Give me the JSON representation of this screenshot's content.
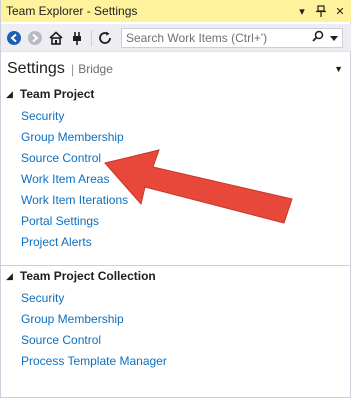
{
  "window": {
    "title": "Team Explorer - Settings"
  },
  "titlebar_buttons": {
    "dropdown": "▾",
    "pin": "ᛋ",
    "close": "✕"
  },
  "toolbar": {
    "search_placeholder": "Search Work Items (Ctrl+')",
    "icons": [
      "back-icon",
      "forward-icon",
      "home-icon",
      "connect-icon",
      "refresh-icon",
      "search-icon",
      "dropdown-icon"
    ]
  },
  "header": {
    "title": "Settings",
    "separator": "|",
    "subtitle": "Bridge",
    "dropdown": "▼"
  },
  "sections": [
    {
      "label": "Team Project",
      "expander": "◢",
      "items": [
        "Security",
        "Group Membership",
        "Source Control",
        "Work Item Areas",
        "Work Item Iterations",
        "Portal Settings",
        "Project Alerts"
      ]
    },
    {
      "label": "Team Project Collection",
      "expander": "◢",
      "items": [
        "Security",
        "Group Membership",
        "Source Control",
        "Process Template Manager"
      ]
    }
  ],
  "colors": {
    "titlebar": "#fff29d",
    "link": "#0e70c0",
    "toolbar": "#eeeef2",
    "arrow": "#e8483a"
  }
}
